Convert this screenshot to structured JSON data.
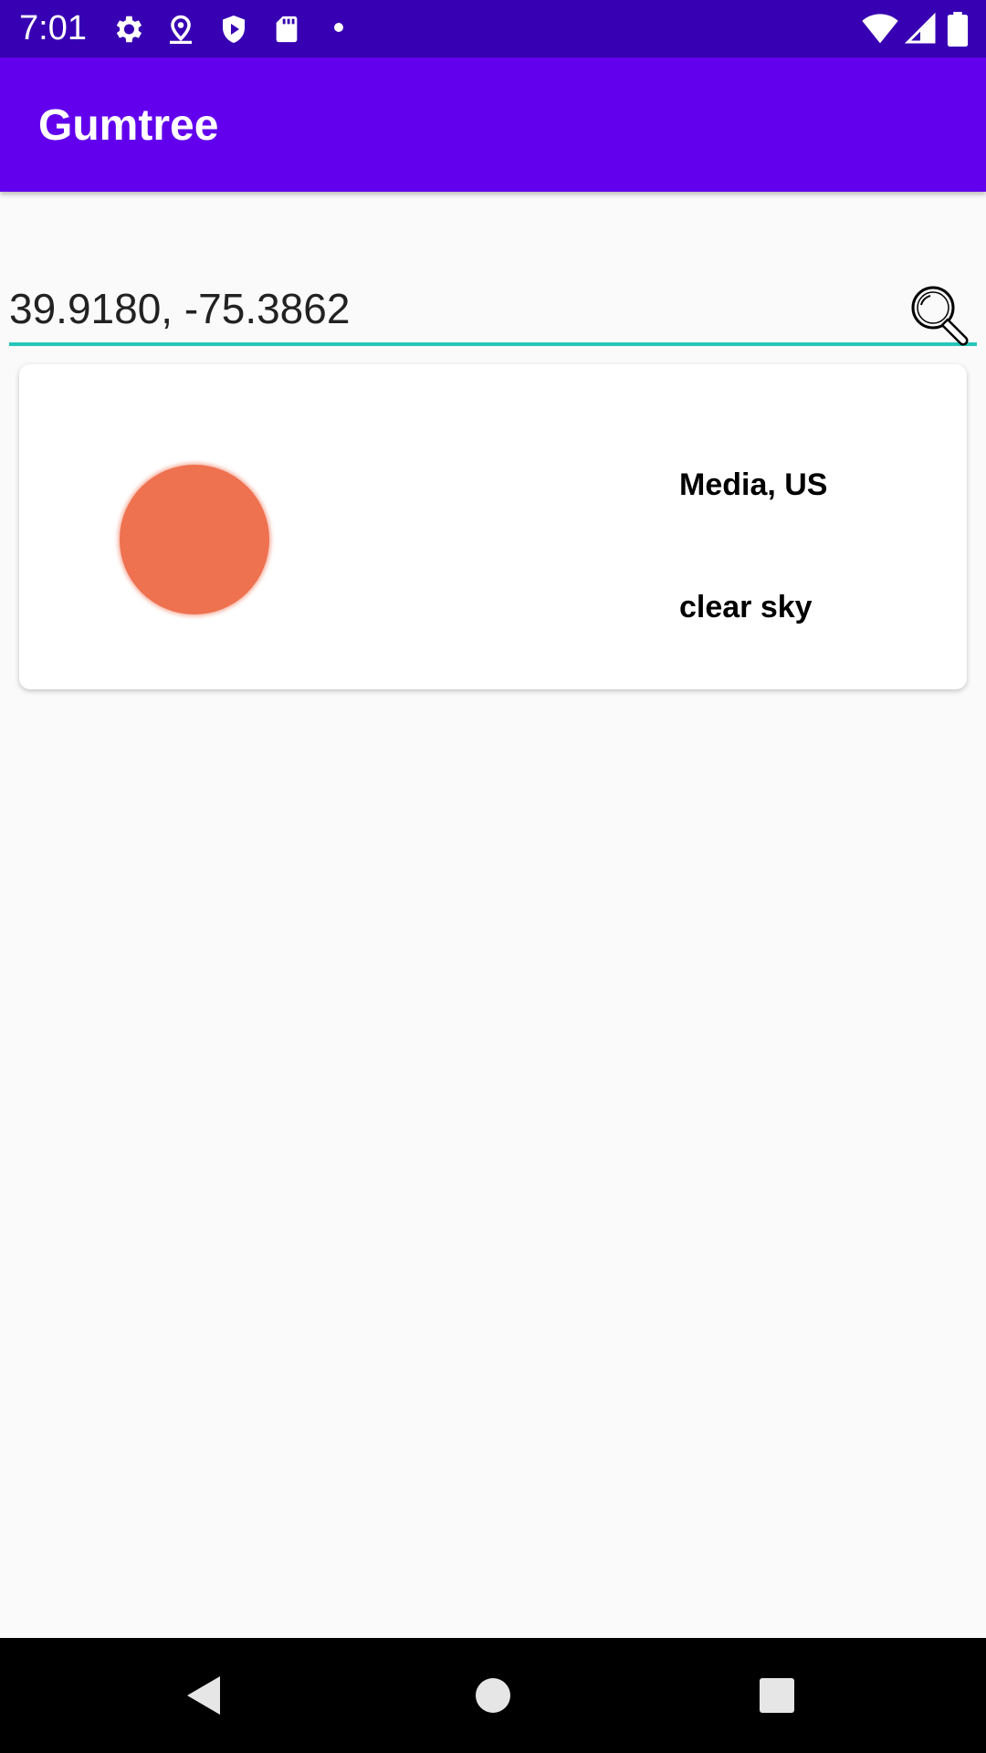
{
  "status_bar": {
    "time": "7:01",
    "icons": [
      "gear-icon",
      "location-icon",
      "shield-play-icon",
      "sd-card-icon",
      "dot-icon",
      "wifi-icon",
      "signal-icon",
      "battery-icon"
    ]
  },
  "app_bar": {
    "title": "Gumtree",
    "color": "#6200ee",
    "status_color": "#3700b3"
  },
  "search": {
    "value": "39.9180, -75.3862",
    "accent_color": "#26c6b9",
    "icon": "search-icon"
  },
  "weather_card": {
    "location": "Media, US",
    "description": "clear sky",
    "icon": "sun-icon",
    "icon_color": "#ee7150"
  },
  "nav_bar": {
    "buttons": [
      "back-icon",
      "home-icon",
      "recents-icon"
    ]
  }
}
